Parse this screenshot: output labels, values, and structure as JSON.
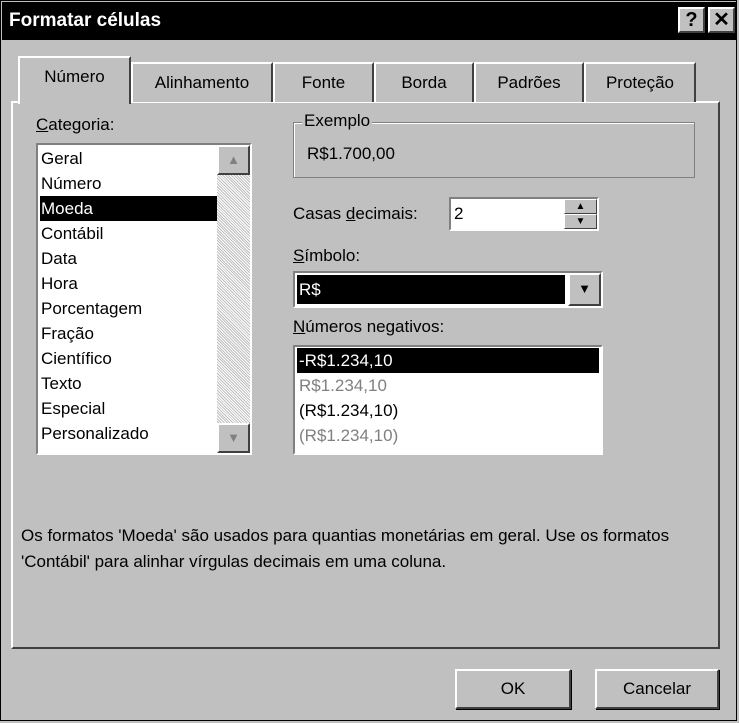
{
  "window": {
    "title": "Formatar células",
    "help_label": "?",
    "close_label": "✕"
  },
  "tabs": [
    {
      "label": "Número",
      "active": true
    },
    {
      "label": "Alinhamento"
    },
    {
      "label": "Fonte"
    },
    {
      "label": "Borda"
    },
    {
      "label": "Padrões"
    },
    {
      "label": "Proteção"
    }
  ],
  "category": {
    "label_first": "C",
    "label_rest": "ategoria:",
    "items": [
      "Geral",
      "Número",
      "Moeda",
      "Contábil",
      "Data",
      "Hora",
      "Porcentagem",
      "Fração",
      "Científico",
      "Texto",
      "Especial",
      "Personalizado"
    ],
    "selected": "Moeda"
  },
  "example": {
    "title": "Exemplo",
    "value": "R$1.700,00"
  },
  "decimals": {
    "label_a": "Casas ",
    "label_u": "d",
    "label_b": "ecimais:",
    "value": "2"
  },
  "symbol": {
    "label_u": "S",
    "label_rest": "ímbolo:",
    "value": "R$"
  },
  "negatives": {
    "label_u": "N",
    "label_rest": "úmeros negativos:",
    "items": [
      "-R$1.234,10",
      "R$1.234,10",
      "(R$1.234,10)",
      "(R$1.234,10)"
    ],
    "item_colors": [
      "#ffffff",
      "#808080",
      "#000000",
      "#808080"
    ]
  },
  "description": "Os formatos 'Moeda' são usados para quantias monetárias em geral. Use os formatos 'Contábil' para alinhar vírgulas decimais em uma coluna.",
  "buttons": {
    "ok": "OK",
    "cancel": "Cancelar"
  }
}
